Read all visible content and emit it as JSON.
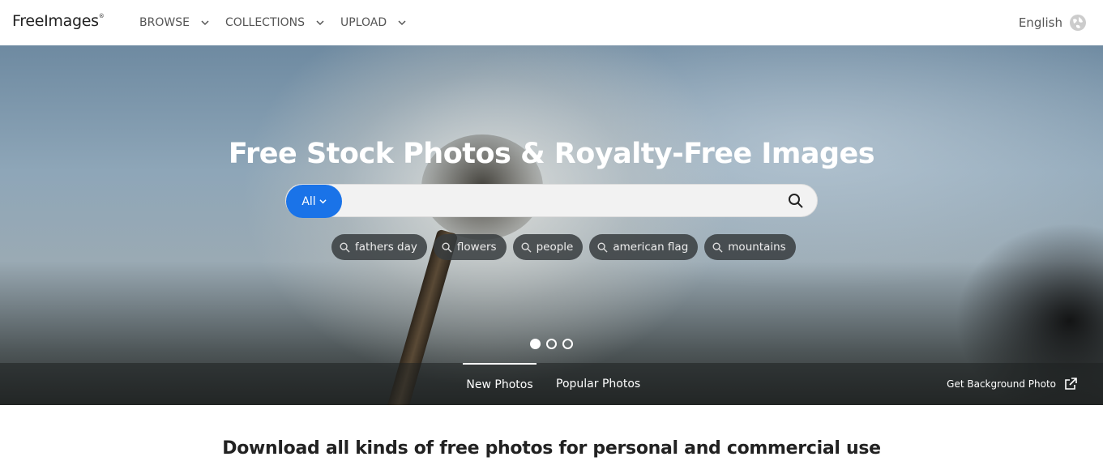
{
  "header": {
    "logo_text": "FreeImages",
    "logo_mark": "®",
    "nav": [
      {
        "label": "BROWSE"
      },
      {
        "label": "COLLECTIONS"
      },
      {
        "label": "UPLOAD"
      }
    ],
    "language": "English"
  },
  "hero": {
    "title": "Free Stock Photos & Royalty-Free Images",
    "search": {
      "category": "All",
      "value": "",
      "placeholder": ""
    },
    "tags": [
      {
        "label": "fathers day"
      },
      {
        "label": "flowers"
      },
      {
        "label": "people"
      },
      {
        "label": "american flag"
      },
      {
        "label": "mountains"
      }
    ],
    "slides": {
      "count": 3,
      "active_index": 0
    }
  },
  "tabs": [
    {
      "label": "New Photos",
      "active": true
    },
    {
      "label": "Popular Photos",
      "active": false
    }
  ],
  "background_link": "Get Background Photo",
  "tagline": "Download all kinds of free photos for personal and commercial use",
  "colors": {
    "accent": "#1a73e8",
    "text": "#222222",
    "nav_text": "#555555"
  },
  "icons": [
    "chevron-down-icon",
    "globe-icon",
    "search-icon",
    "external-link-icon"
  ]
}
